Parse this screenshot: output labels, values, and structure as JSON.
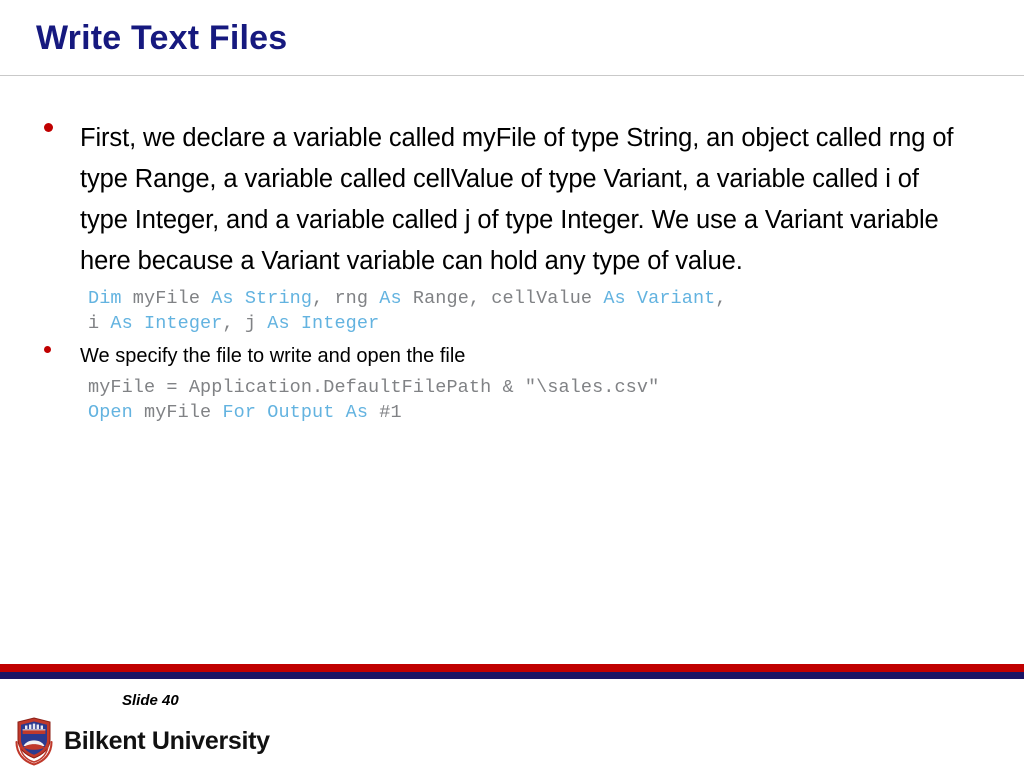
{
  "slide": {
    "title": "Write Text Files",
    "title_color": "#16197f",
    "background": "#ffffff",
    "bullet_color": "#c00000"
  },
  "body": {
    "bullets": [
      {
        "level": "primary",
        "text": "First, we declare a variable called myFile of type String, an object called rng of type Range, a variable called cellValue of type Variant, a variable called i of type Integer, and a variable called j of type Integer. We use a Variant variable here because a Variant variable can hold any type of value."
      },
      {
        "level": "secondary",
        "text": "We specify the file to write and open the file"
      }
    ],
    "code_blocks": [
      {
        "id": "declaration",
        "lines": [
          [
            {
              "t": "Dim",
              "c": "kw"
            },
            {
              "t": " myFile ",
              "c": "pl"
            },
            {
              "t": "As String",
              "c": "kw"
            },
            {
              "t": ", rng ",
              "c": "pl"
            },
            {
              "t": "As",
              "c": "kw"
            },
            {
              "t": " Range, cellValue ",
              "c": "pl"
            },
            {
              "t": "As Variant",
              "c": "kw"
            },
            {
              "t": ",",
              "c": "pl"
            }
          ],
          [
            {
              "t": "i ",
              "c": "pl"
            },
            {
              "t": "As Integer",
              "c": "kw"
            },
            {
              "t": ", j ",
              "c": "pl"
            },
            {
              "t": "As Integer",
              "c": "kw"
            }
          ]
        ]
      },
      {
        "id": "open-file",
        "lines": [
          [
            {
              "t": "myFile = Application.DefaultFilePath & \"\\sales.csv\"",
              "c": "pl"
            }
          ],
          [
            {
              "t": "Open",
              "c": "kw"
            },
            {
              "t": " myFile ",
              "c": "pl"
            },
            {
              "t": "For Output As",
              "c": "kw"
            },
            {
              "t": " #1",
              "c": "pl"
            }
          ]
        ]
      }
    ]
  },
  "footer": {
    "bar_red_color": "#c00000",
    "bar_navy_color": "#1b1464",
    "slide_number": "Slide 40",
    "brand_name": "Bilkent University",
    "logo_icon": "bilkent-shield-crest-icon"
  },
  "code_theme": {
    "keyword_color": "#63b3e0",
    "plain_color": "#808285"
  }
}
